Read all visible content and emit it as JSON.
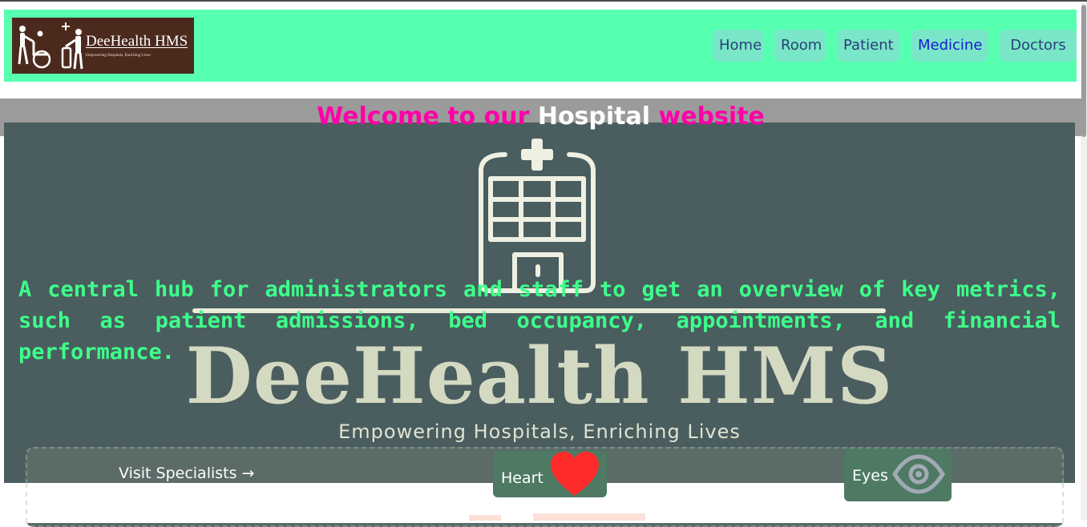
{
  "header": {
    "logo": {
      "name": "DeeHealth HMS",
      "tagline": "Empowering Hospitals, Enriching Lives"
    },
    "nav": [
      {
        "label": "Home"
      },
      {
        "label": "Room"
      },
      {
        "label": "Patient"
      },
      {
        "label": "Medicine",
        "active": true
      },
      {
        "label": "Doctors"
      }
    ]
  },
  "hero": {
    "welcome": {
      "part1": "Welcome to our ",
      "part2": "Hospital",
      "part3": " website"
    },
    "brand_name": "DeeHealth HMS",
    "brand_tagline": "Empowering Hospitals, Enriching Lives",
    "description": "A central hub for administrators and staff to get an overview of key metrics, such as patient admissions, bed occupancy, appointments, and financial performance."
  },
  "services": {
    "visit_link": "Visit Specialists →",
    "cards": [
      {
        "label": "Heart",
        "icon": "heart-icon"
      },
      {
        "label": "Eyes",
        "icon": "eye-icon"
      }
    ]
  },
  "colors": {
    "header_bg": "#57ffb0",
    "nav_bg": "#7ae6c8",
    "hero_bg": "#4a5d5f",
    "welcome_pink": "#ff00a8",
    "lead_green": "#3dff8a",
    "card_green": "#4e7a64",
    "heart_red": "#ff2a2a"
  }
}
